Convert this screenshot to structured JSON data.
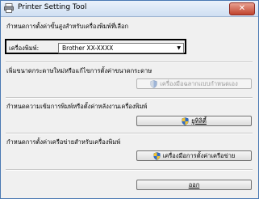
{
  "window": {
    "title": "Printer Setting Tool",
    "close_label": "✕"
  },
  "printer_section": {
    "heading": "กำหนดการตั้งค่าขั้นสูงสำหรับเครื่องพิมพ์ที่เลือก",
    "printer_label": "เครื่องพิมพ์:",
    "printer_value": "Brother XX-XXXX"
  },
  "paper_section": {
    "description": "เพิ่มขนาดกระดาษใหม่หรือแก้ไขการตั้งค่าขนาดกระดาษ",
    "button_label": "เครื่องมือฉลากแบบกำหนดเอง",
    "button_disabled": true
  },
  "utility_section": {
    "description": "กำหนดความเข้มการพิมพ์หรือตั้งค่าหลังงานเครื่องพิมพ์",
    "button_label": "ยูทิลิตี้"
  },
  "network_section": {
    "description": "กำหนดการตั้งค่าเครือข่ายสำหรับเครื่องพิมพ์",
    "button_label": "เครื่องมือการตั้งค่าเครือข่าย"
  },
  "footer": {
    "exit_label": "ออก"
  },
  "colors": {
    "title_bar": "#cfdff2",
    "close_button": "#c0432d",
    "shield_blue": "#2f6cc8",
    "shield_yellow": "#f2c230"
  }
}
